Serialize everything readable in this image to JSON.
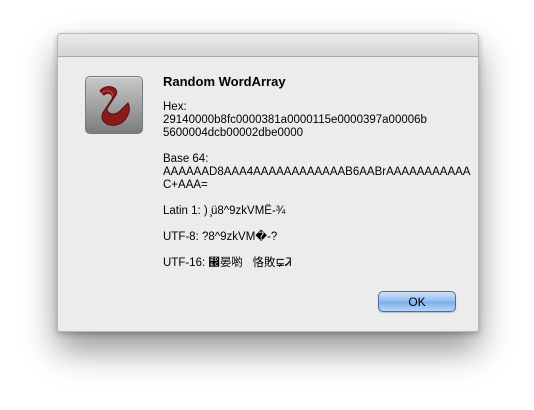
{
  "dialog": {
    "title": "Random WordArray",
    "hex_label": "Hex:",
    "hex_value": "29140000b8fc0000381a0000115e0000397a00006b\n5600004dcb00002dbe0000",
    "base64_label": "Base 64:",
    "base64_value": "AAAAAAD8AAA4AAAAAAAAAAAAB6AABrAAAAAAAAAAA\nC+AAA=",
    "latin1_line": "Latin 1: ) ̧ü8^9zkVMË-¾",
    "utf8_line": "UTF-8: ?8^9zkVM�-?",
    "utf16_line": "UTF-16: ⵬晏喲   恪敗‌⋤‌Ꮨ",
    "ok_label": "OK"
  },
  "icons": {
    "app_icon": "script-scroll-icon"
  },
  "colors": {
    "dialog_bg": "#ececec",
    "icon_scroll": "#8b1a1a",
    "button_blue": "#8fbbef"
  }
}
